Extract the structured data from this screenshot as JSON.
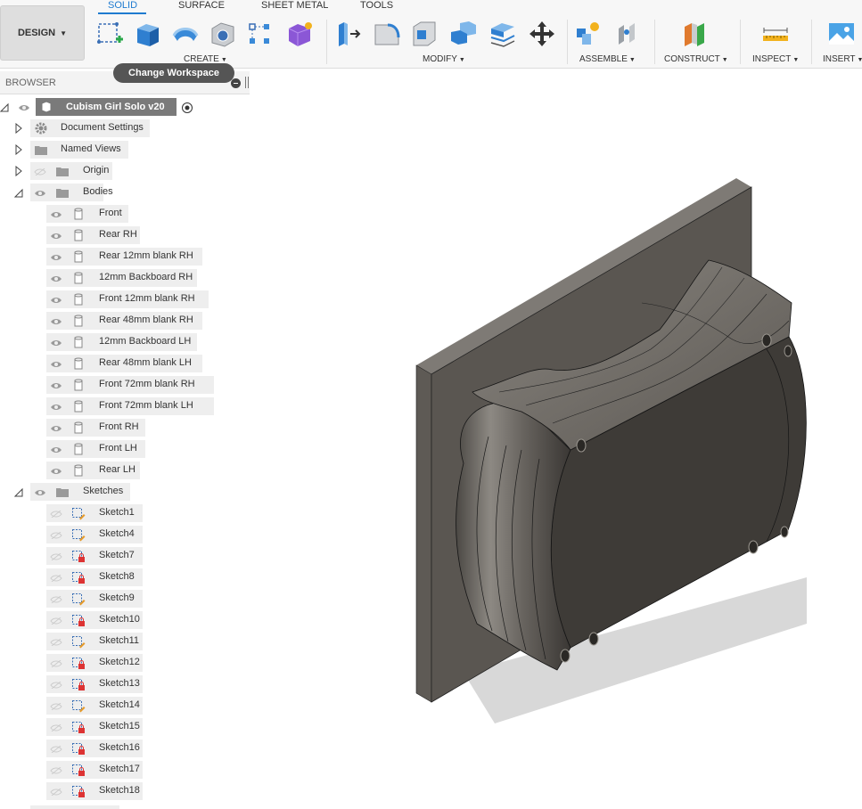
{
  "toolbar": {
    "design_label": "DESIGN",
    "tabs": [
      "SOLID",
      "SURFACE",
      "SHEET METAL",
      "TOOLS"
    ],
    "groups": [
      "CREATE",
      "MODIFY",
      "ASSEMBLE",
      "CONSTRUCT",
      "INSPECT",
      "INSERT"
    ]
  },
  "tooltip": "Change Workspace",
  "browser": {
    "title": "BROWSER",
    "root": "Cubism Girl Solo v20",
    "top_nodes": [
      "Document Settings",
      "Named Views",
      "Origin",
      "Bodies"
    ],
    "bodies": [
      "Front",
      "Rear RH",
      "Rear 12mm blank RH",
      "12mm Backboard RH",
      "Front 12mm blank RH",
      "Rear 48mm blank RH",
      "12mm Backboard LH",
      "Rear 48mm blank LH",
      "Front  72mm blank RH",
      "Front  72mm blank LH",
      "Front RH",
      "Front LH",
      "Rear LH"
    ],
    "sketches_label": "Sketches",
    "sketches": [
      "Sketch1",
      "Sketch4",
      "Sketch7",
      "Sketch8",
      "Sketch9",
      "Sketch10",
      "Sketch11",
      "Sketch12",
      "Sketch13",
      "Sketch14",
      "Sketch15",
      "Sketch16",
      "Sketch17",
      "Sketch18"
    ]
  },
  "colors": {
    "accent": "#1f7bd0",
    "body": "#4f4c47",
    "backboard": "#5a5651"
  }
}
